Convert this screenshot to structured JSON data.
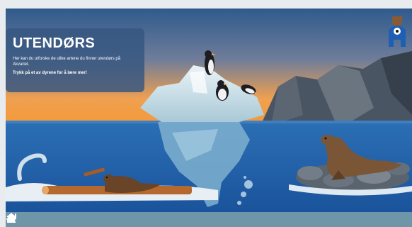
{
  "info": {
    "title": "UTENDØRS",
    "description": "Her kan du utforske de ulike artene du finner utendørs på Akvariet.",
    "call_to_action": "Trykk på et av dyrene for å lære mer!"
  },
  "colors": {
    "sky_top": "#2f5a8c",
    "sky_bottom": "#f39a3b",
    "sea": "#1f5fa8",
    "card_bg": "#355580",
    "toolbar_bg": "#6f95a8",
    "mascot_blue": "#1f5fb3"
  },
  "toolbar": {
    "icons": [
      "back-arrow-icon",
      "home-icon",
      "puzzle-icon"
    ]
  }
}
